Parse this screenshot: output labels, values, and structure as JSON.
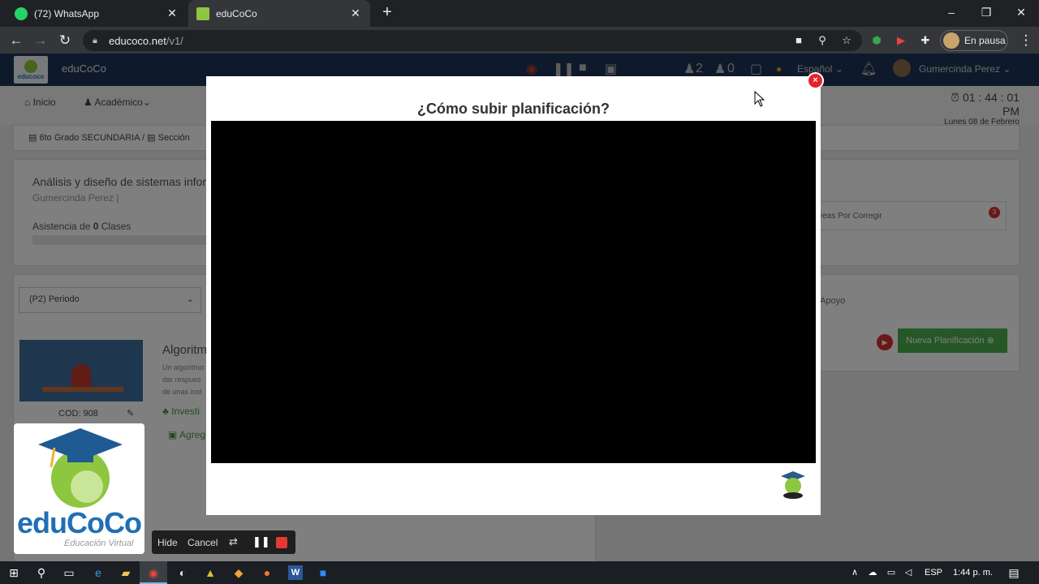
{
  "browser": {
    "tabs": [
      {
        "title": "(72) WhatsApp",
        "favicon_color": "#25D366",
        "active": false
      },
      {
        "title": "eduCoCo",
        "favicon_color": "#8dc63f",
        "active": true
      }
    ],
    "new_tab": "+",
    "window_controls": {
      "minimize": "–",
      "maximize": "❐",
      "close": "✕"
    },
    "url_host": "educoco.net",
    "url_path": "/v1/",
    "profile_label": "En pausa"
  },
  "app": {
    "name": "eduCoCo",
    "logo_text": "educoco",
    "header": {
      "count_a": "2",
      "count_b": "0",
      "language": "Español ⌄",
      "user": "Gumercinda Perez ⌄"
    },
    "nav": {
      "home": "Inicio",
      "academic": "Académico⌄"
    },
    "clock": {
      "time": "01 : 44 : 01 PM",
      "date": "Lunes 08 de Febrero"
    },
    "breadcrumb": [
      "6to Grado SECUNDARIA /",
      "Sección"
    ],
    "course": {
      "title": "Análisis y diseño de sistemas infor",
      "teacher": "Gumercinda Perez |",
      "attendance_label": "Asistencia de",
      "attendance_count": "0",
      "attendance_suffix": "Clases"
    },
    "period_select": "(P2) Periodo",
    "card": {
      "code": "COD: 908",
      "title": "Algoritm",
      "desc": "Un algoritmo dar respues de unas inst",
      "link1": "Investi",
      "link2": "Agreg"
    },
    "right": {
      "to_correct": "reas Por Corregir",
      "badge": "3",
      "support": "Apoyo",
      "new_plan": "Nueva Planificación ⊕"
    }
  },
  "modal": {
    "title": "¿Cómo subir planificación?",
    "close": "×"
  },
  "overlay": {
    "brand": "eduCoCo",
    "tagline": "Educación Virtual"
  },
  "recorder": {
    "hide": "Hide",
    "cancel": "Cancel"
  },
  "taskbar": {
    "lang": "ESP",
    "time": "1:44 p. m."
  }
}
